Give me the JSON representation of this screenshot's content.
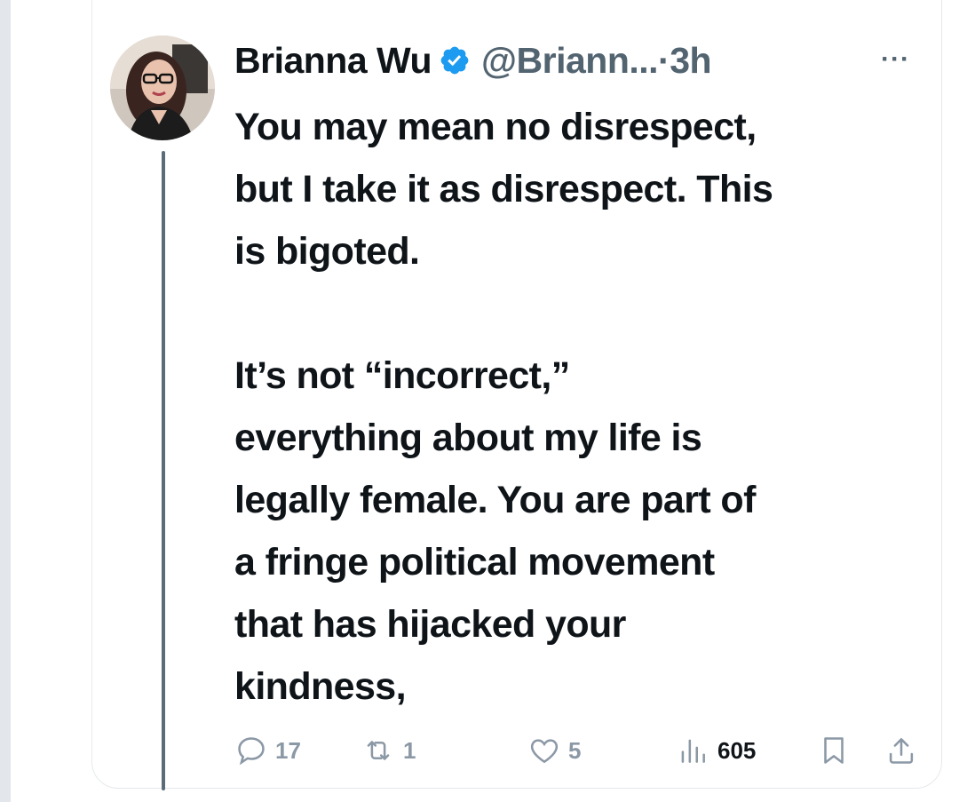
{
  "tweet": {
    "author_name": "Brianna Wu",
    "handle": "@Briann...",
    "separator": "·",
    "time": "3h",
    "more": "···",
    "paragraph1_line1": "You may mean no disrespect,",
    "paragraph1_line2": "but I take it as disrespect. This",
    "paragraph1_line3": "is bigoted.",
    "paragraph2_line1": "It’s not “incorrect,”",
    "paragraph2_line2": "everything about my life is",
    "paragraph2_line3": "legally female. You are part of",
    "paragraph2_line4": "a fringe political movement",
    "paragraph2_line5": "that has hijacked your",
    "paragraph2_line6": "kindness,"
  },
  "actions": {
    "replies": "17",
    "retweets": "1",
    "likes": "5",
    "views": "605"
  },
  "icons": {
    "avatar": "avatar",
    "verified": "verified-badge-icon",
    "more": "more-icon",
    "reply": "reply-icon",
    "retweet": "retweet-icon",
    "like": "heart-icon",
    "views": "views-icon",
    "bookmark": "bookmark-icon",
    "share": "share-icon"
  },
  "colors": {
    "text": "#0f1419",
    "secondary": "#536471",
    "action_gray": "#8b98a5",
    "verified_blue": "#1d9bf0",
    "thread_line": "#5b6b78"
  }
}
